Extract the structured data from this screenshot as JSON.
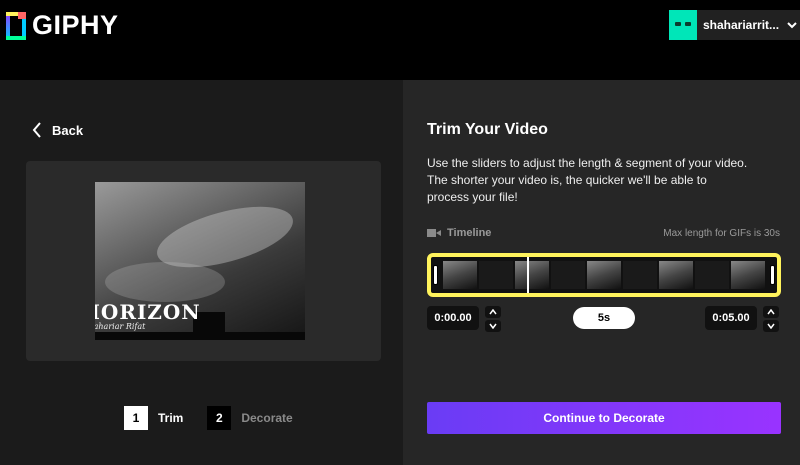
{
  "header": {
    "logo_text": "GIPHY",
    "username": "shahariarrit...",
    "avatar_color": "#00e6b8"
  },
  "left": {
    "back_label": "Back",
    "preview": {
      "overlay_kicker": "• · · ·",
      "overlay_title": "HORIZON",
      "overlay_signature": "Shahariar Rifat"
    },
    "steps": [
      {
        "number": "1",
        "label": "Trim"
      },
      {
        "number": "2",
        "label": "Decorate"
      }
    ]
  },
  "right": {
    "title": "Trim Your Video",
    "description": "Use the sliders to adjust the length & segment of your video. The shorter your video is, the quicker we'll be able to process your file!",
    "timeline_label": "Timeline",
    "max_length": "Max length for GIFs is 30s",
    "start_time": "0:00.00",
    "duration": "5s",
    "end_time": "0:05.00",
    "cta_label": "Continue to Decorate"
  },
  "colors": {
    "trim_border": "#fff35c",
    "cta_start": "#6a3cf5",
    "cta_end": "#9933ff"
  }
}
